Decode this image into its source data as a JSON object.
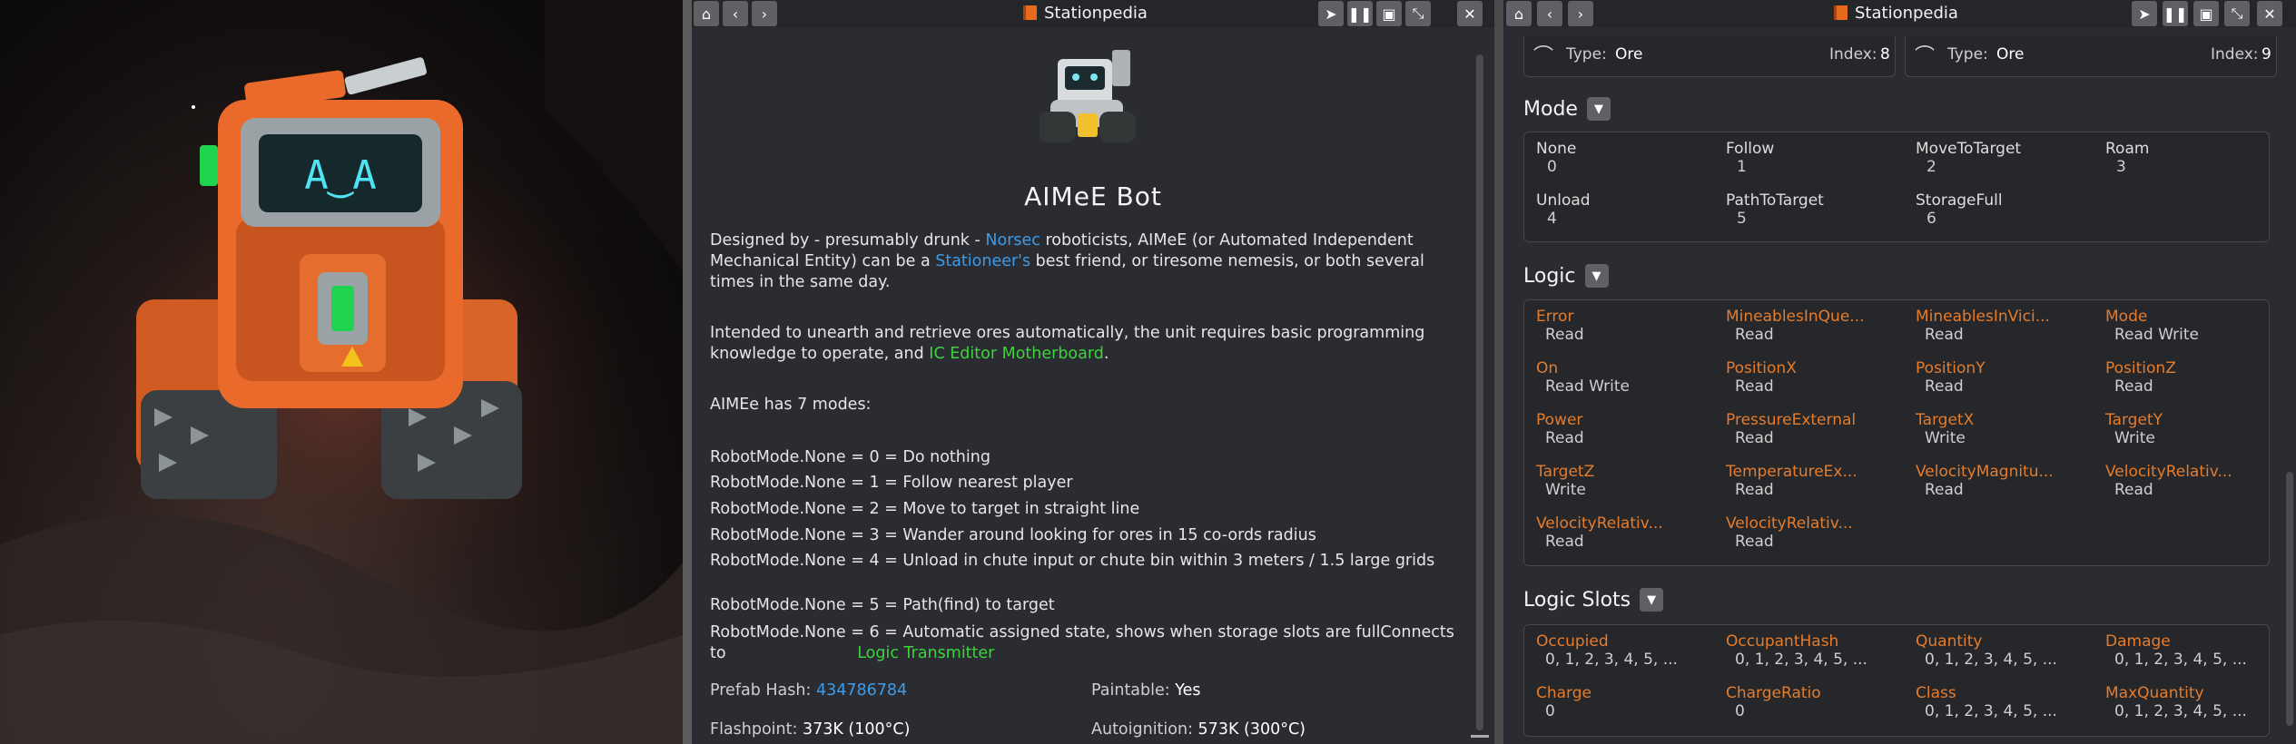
{
  "left_panel": {
    "title": "Stationpedia",
    "item_name": "AIMeE Bot",
    "desc1_a": "Designed by - presumably drunk - ",
    "desc1_link1": "Norsec",
    "desc1_b": " roboticists, AIMeE (or Automated Independent Mechanical Entity) can be a ",
    "desc1_link2": "Stationeer's",
    "desc1_c": " best friend, or tiresome nemesis, or both several times in the same day.",
    "desc2_a": "Intended to unearth and retrieve ores automatically, the unit requires basic programming knowledge to operate, and ",
    "desc2_link": "IC Editor Motherboard",
    "desc2_b": ".",
    "modes_intro": "AIMEe has 7 modes:",
    "mode_lines": [
      "RobotMode.None = 0 = Do nothing",
      "RobotMode.None = 1 = Follow nearest player",
      "RobotMode.None = 2 = Move to target in straight line",
      "RobotMode.None = 3 = Wander around looking for ores in 15 co-ords radius",
      "RobotMode.None = 4 = Unload in chute input or chute bin within 3 meters / 1.5 large grids",
      "RobotMode.None = 5 = Path(find) to target"
    ],
    "mode6_a": "RobotMode.None = 6 = Automatic assigned state, shows when storage slots are fullConnects to",
    "mode6_link": "Logic Transmitter",
    "prefab_label": "Prefab Hash: ",
    "prefab_value": "434786784",
    "paintable_label": "Paintable: ",
    "paintable_value": "Yes",
    "flashpoint_label": "Flashpoint: ",
    "flashpoint_value": "373K (100°C)",
    "autoignition_label": "Autoignition: ",
    "autoignition_value": "573K (300°C)"
  },
  "right_panel": {
    "title": "Stationpedia",
    "ore_cards": [
      {
        "type_label": "Type:",
        "type_value": "Ore",
        "index_label": "Index:",
        "index_value": "8"
      },
      {
        "type_label": "Type:",
        "type_value": "Ore",
        "index_label": "Index:",
        "index_value": "9"
      }
    ],
    "mode_title": "Mode",
    "modes": [
      {
        "name": "None",
        "value": "0"
      },
      {
        "name": "Follow",
        "value": "1"
      },
      {
        "name": "MoveToTarget",
        "value": "2"
      },
      {
        "name": "Roam",
        "value": "3"
      },
      {
        "name": "Unload",
        "value": "4"
      },
      {
        "name": "PathToTarget",
        "value": "5"
      },
      {
        "name": "StorageFull",
        "value": "6"
      }
    ],
    "logic_title": "Logic",
    "logic": [
      {
        "name": "Error",
        "access": "Read"
      },
      {
        "name": "MineablesInQue...",
        "access": "Read"
      },
      {
        "name": "MineablesInVici...",
        "access": "Read"
      },
      {
        "name": "Mode",
        "access": "Read Write"
      },
      {
        "name": "On",
        "access": "Read Write"
      },
      {
        "name": "PositionX",
        "access": "Read"
      },
      {
        "name": "PositionY",
        "access": "Read"
      },
      {
        "name": "PositionZ",
        "access": "Read"
      },
      {
        "name": "Power",
        "access": "Read"
      },
      {
        "name": "PressureExternal",
        "access": "Read"
      },
      {
        "name": "TargetX",
        "access": "Write"
      },
      {
        "name": "TargetY",
        "access": "Write"
      },
      {
        "name": "TargetZ",
        "access": "Write"
      },
      {
        "name": "TemperatureEx...",
        "access": "Read"
      },
      {
        "name": "VelocityMagnitu...",
        "access": "Read"
      },
      {
        "name": "VelocityRelativ...",
        "access": "Read"
      },
      {
        "name": "VelocityRelativ...",
        "access": "Read"
      },
      {
        "name": "VelocityRelativ...",
        "access": "Read"
      }
    ],
    "slots_title": "Logic Slots",
    "slots": [
      {
        "name": "Occupied",
        "value": "0, 1, 2, 3, 4, 5, ..."
      },
      {
        "name": "OccupantHash",
        "value": "0, 1, 2, 3, 4, 5, ..."
      },
      {
        "name": "Quantity",
        "value": "0, 1, 2, 3, 4, 5, ..."
      },
      {
        "name": "Damage",
        "value": "0, 1, 2, 3, 4, 5, ..."
      },
      {
        "name": "Charge",
        "value": "0"
      },
      {
        "name": "ChargeRatio",
        "value": "0"
      },
      {
        "name": "Class",
        "value": "0, 1, 2, 3, 4, 5, ..."
      },
      {
        "name": "MaxQuantity",
        "value": "0, 1, 2, 3, 4, 5, ..."
      }
    ]
  },
  "robot_face": "A‿A",
  "colors": {
    "link_blue": "#3d9be8",
    "link_green": "#3ed33e",
    "logic_orange": "#e57c2c",
    "robot_orange": "#e96a2a"
  },
  "icons": [
    "home-icon",
    "back-icon",
    "forward-icon",
    "cursor-icon",
    "pause-icon",
    "window-icon",
    "minimize-icon",
    "close-icon",
    "book-icon",
    "chevron-down-icon"
  ]
}
